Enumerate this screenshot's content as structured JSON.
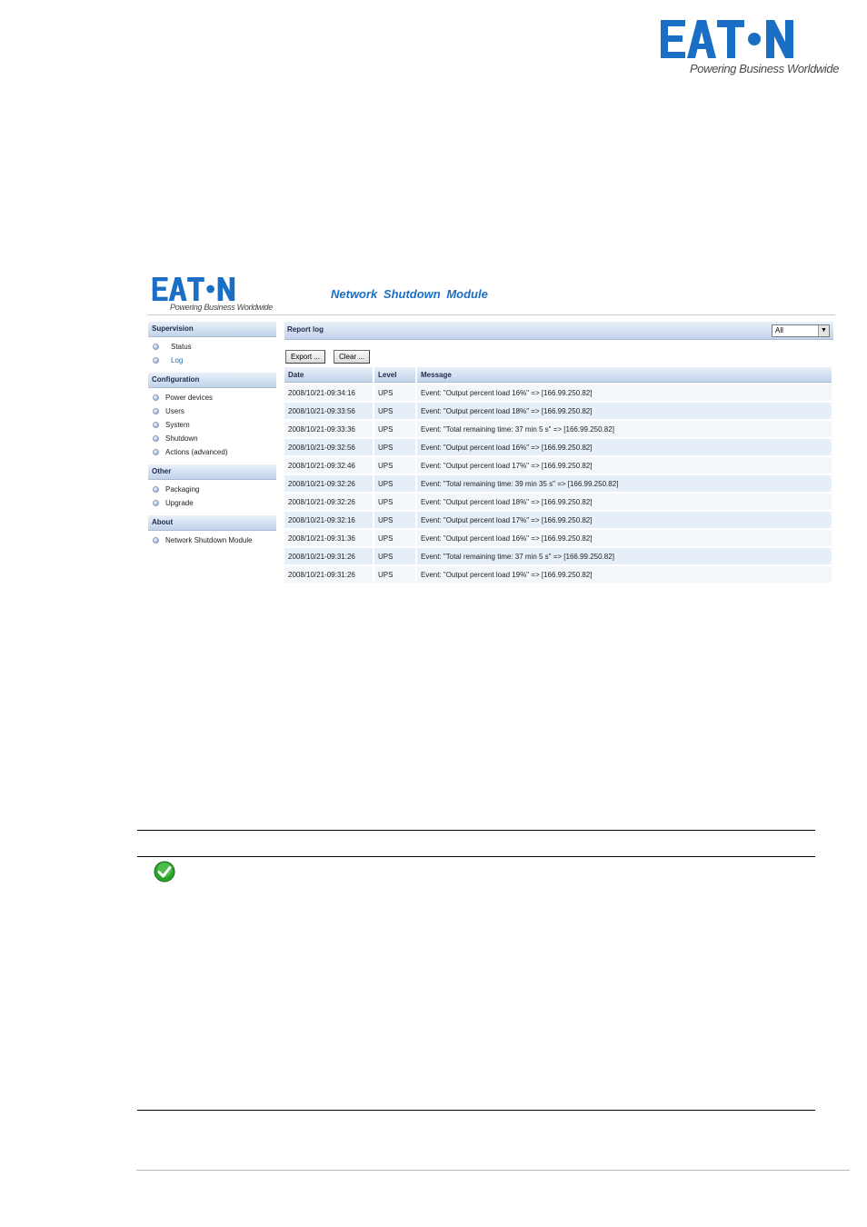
{
  "brand": {
    "logo_text": "EATON",
    "tagline": "Powering Business Worldwide",
    "color": "#1a6fc4"
  },
  "app": {
    "title": "Network  Shutdown  Module"
  },
  "sidebar": {
    "sections": [
      {
        "heading": "Supervision",
        "items": [
          {
            "label": "Status",
            "active": false
          },
          {
            "label": "Log",
            "active": true
          }
        ]
      },
      {
        "heading": "Configuration",
        "items": [
          {
            "label": "Power devices"
          },
          {
            "label": "Users"
          },
          {
            "label": "System"
          },
          {
            "label": "Shutdown"
          },
          {
            "label": "Actions (advanced)"
          }
        ]
      },
      {
        "heading": "Other",
        "items": [
          {
            "label": "Packaging"
          },
          {
            "label": "Upgrade"
          }
        ]
      },
      {
        "heading": "About",
        "items": [
          {
            "label": "Network Shutdown Module"
          }
        ]
      }
    ]
  },
  "report": {
    "title": "Report log",
    "filter_value": "All",
    "export_label": "Export ...",
    "clear_label": "Clear ...",
    "columns": [
      "Date",
      "Level",
      "Message"
    ],
    "rows": [
      [
        "2008/10/21-09:34:16",
        "UPS",
        "Event: \"Output percent load 16%\" => [166.99.250.82]"
      ],
      [
        "2008/10/21-09:33:56",
        "UPS",
        "Event: \"Output percent load 18%\" => [166.99.250.82]"
      ],
      [
        "2008/10/21-09:33:36",
        "UPS",
        "Event: \"Total remaining time: 37 min 5 s\" => [166.99.250.82]"
      ],
      [
        "2008/10/21-09:32:56",
        "UPS",
        "Event: \"Output percent load 16%\" => [166.99.250.82]"
      ],
      [
        "2008/10/21-09:32:46",
        "UPS",
        "Event: \"Output percent load 17%\" => [166.99.250.82]"
      ],
      [
        "2008/10/21-09:32:26",
        "UPS",
        "Event: \"Total remaining time: 39 min 35 s\" => [166.99.250.82]"
      ],
      [
        "2008/10/21-09:32:26",
        "UPS",
        "Event: \"Output percent load 18%\" => [166.99.250.82]"
      ],
      [
        "2008/10/21-09:32:16",
        "UPS",
        "Event: \"Output percent load 17%\" => [166.99.250.82]"
      ],
      [
        "2008/10/21-09:31:36",
        "UPS",
        "Event: \"Output percent load 16%\" => [166.99.250.82]"
      ],
      [
        "2008/10/21-09:31:26",
        "UPS",
        "Event: \"Total remaining time: 37 min 5 s\" => [166.99.250.82]"
      ],
      [
        "2008/10/21-09:31:26",
        "UPS",
        "Event: \"Output percent load 19%\" => [166.99.250.82]"
      ]
    ]
  },
  "note": {
    "icon": "check-icon",
    "icon_color": "#2aa52a"
  }
}
